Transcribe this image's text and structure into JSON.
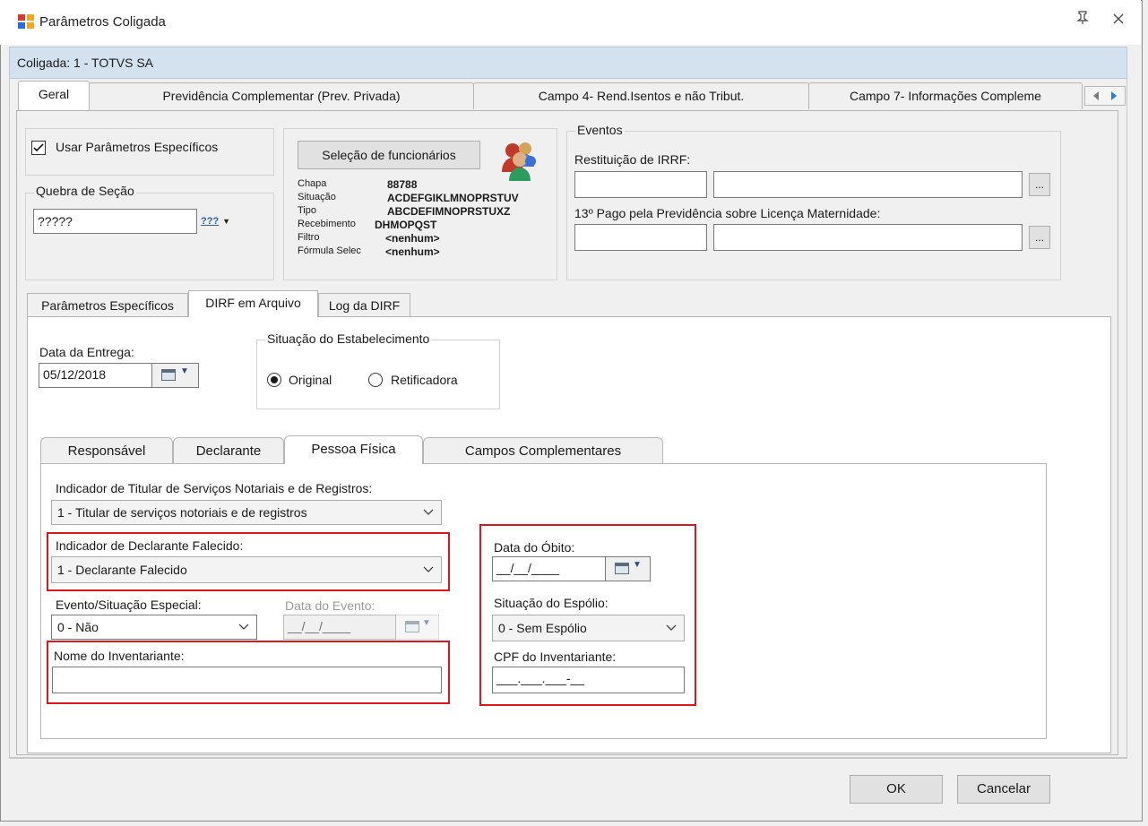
{
  "window": {
    "title": "Parâmetros Coligada",
    "coligada": "Coligada: 1 - TOTVS SA"
  },
  "top_tabs": [
    {
      "label": "Geral"
    },
    {
      "label": "Previdência Complementar (Prev. Privada)"
    },
    {
      "label": "Campo 4- Rend.Isentos e não Tribut."
    },
    {
      "label": "Campo 7- Informações Compleme"
    }
  ],
  "params": {
    "usar_especificos": "Usar Parâmetros Específicos",
    "usar_especificos_checked": true,
    "quebra_legend": "Quebra de Seção",
    "quebra_value": "?????",
    "quebra_btn": "???"
  },
  "selecao": {
    "button": "Seleção de funcionários",
    "rows": [
      {
        "label": "Chapa",
        "value": "88788"
      },
      {
        "label": "Situação",
        "value": "ACDEFGIKLMNOPRSTUV"
      },
      {
        "label": "Tipo",
        "value": "ABCDEFIMNOPRSTUXZ"
      },
      {
        "label": "Recebimento",
        "value": "DHMOPQST"
      },
      {
        "label": "Filtro",
        "value": "<nenhum>"
      },
      {
        "label": "Fórmula Selec",
        "value": "<nenhum>"
      }
    ]
  },
  "eventos": {
    "legend": "Eventos",
    "restituicao_label": "Restituição de IRRF:",
    "decimo_label": "13º Pago pela Previdência sobre Licença Maternidade:",
    "lookup_btn": "..."
  },
  "sub_tabs": [
    {
      "label": "Parâmetros Específicos"
    },
    {
      "label": "DIRF em Arquivo"
    },
    {
      "label": "Log da DIRF"
    }
  ],
  "dirf": {
    "data_entrega_label": "Data da Entrega:",
    "data_entrega_value": "05/12/2018",
    "situacao_legend": "Situação do Estabelecimento",
    "radio_original": "Original",
    "radio_retificadora": "Retificadora",
    "selected": "Original"
  },
  "inner_tabs": [
    {
      "label": "Responsável"
    },
    {
      "label": "Declarante"
    },
    {
      "label": "Pessoa Física"
    },
    {
      "label": "Campos Complementares"
    }
  ],
  "pessoa_fisica": {
    "indicador_titular_label": "Indicador de Titular de Serviços Notariais e de Registros:",
    "indicador_titular_value": "1 - Titular de serviços notoriais e de registros",
    "indicador_falecido_label": "Indicador de Declarante Falecido:",
    "indicador_falecido_value": "1 - Declarante Falecido",
    "evento_label": "Evento/Situação Especial:",
    "evento_value": "0 - Não",
    "data_evento_label": "Data do Evento:",
    "data_evento_value": "__/__/____",
    "nome_inventariante_label": "Nome do Inventariante:",
    "nome_inventariante_value": "",
    "data_obito_label": "Data do Óbito:",
    "data_obito_value": "__/__/____",
    "situacao_espolio_label": "Situação do Espólio:",
    "situacao_espolio_value": "0 - Sem Espólio",
    "cpf_label": "CPF do Inventariante:",
    "cpf_value": "___.___.___-__"
  },
  "footer": {
    "ok": "OK",
    "cancelar": "Cancelar"
  }
}
